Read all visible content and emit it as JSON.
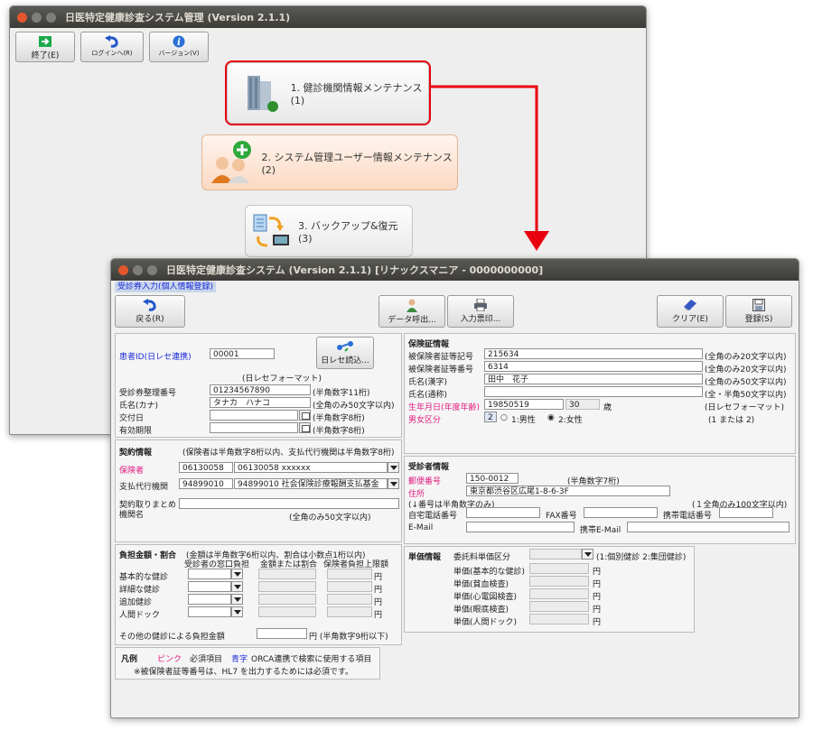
{
  "back_window": {
    "title": "日医特定健康診査システム管理 (Version 2.1.1)",
    "toolbar": {
      "exit": "終了(E)",
      "login": "ログインへ(R)",
      "version": "バージョン(V)"
    },
    "menu": [
      "1. 健診機関情報メンテナンス(1)",
      "2. システム管理ユーザー情報メンテナンス(2)",
      "3. バックアップ&復元(3)"
    ]
  },
  "front_window": {
    "title": "日医特定健康診査システム (Version 2.1.1) [リナックスマニア - 0000000000]",
    "subtitle": "受診券入力(個人情報登録)",
    "toolbar": {
      "back": "戻る(R)",
      "data_call": "データ呼出...",
      "print": "入力票印...",
      "clear": "クリア(E)",
      "register": "登録(S)"
    },
    "patient": {
      "id_label": "患者ID(日レセ連携)",
      "id_value": "00001",
      "read_button": "日レセ読込...",
      "format_note": "(日レセフォーマット)",
      "rows": [
        {
          "label": "受診券整理番号",
          "value": "01234567890",
          "note": "(半角数字11桁)"
        },
        {
          "label": "氏名(カナ)",
          "value": "タナカ　ハナコ",
          "note": "(全角のみ50文字以内)"
        },
        {
          "label": "交付日",
          "value": "",
          "note": "(半角数字8桁)"
        },
        {
          "label": "有効期限",
          "value": "",
          "note": "(半角数字8桁)"
        }
      ]
    },
    "contract": {
      "title": "契約情報",
      "note": "(保険者は半角数字8桁以内、支払代行機関は半角数字8桁)",
      "insurer_label": "保険者",
      "insurer_code": "06130058",
      "insurer_value": "06130058 xxxxxx",
      "agent_label": "支払代行機関",
      "agent_code": "94899010",
      "agent_value": "94899010 社会保険診療報酬支払基金",
      "summary_label_1": "契約取りまとめ",
      "summary_label_2": "機関名",
      "summary_note": "(全角のみ50文字以内)"
    },
    "burden": {
      "title": "負担金額・割合",
      "note": "(金額は半角数字6桁以内、割合は小数点1桁以内)",
      "col1": "受診者の窓口負担",
      "col2": "金額または割合",
      "col3": "保険者負担上限額",
      "rows": [
        "基本的な健診",
        "詳細な健診",
        "追加健診",
        "人間ドック"
      ],
      "unit": "円",
      "other_label": "その他の健診による負担金額",
      "other_note": "円 (半角数字9桁以下)"
    },
    "legend": {
      "title": "凡例",
      "pink": "ピンク",
      "pink_desc": "必須項目",
      "blue": "青字",
      "blue_desc": "ORCA連携で検索に使用する項目",
      "note": "※被保険者証等番号は、HL7 を出力するためには必須です。"
    },
    "insurance": {
      "title": "保険証情報",
      "rows": [
        {
          "label": "被保険者証等記号",
          "value": "215634",
          "note": "(全角のみ20文字以内)"
        },
        {
          "label": "被保険者証等番号",
          "value": "6314",
          "note": "(全角のみ20文字以内)"
        },
        {
          "label": "氏名(漢字)",
          "value": "田中　花子",
          "note": "(全角のみ50文字以内)"
        },
        {
          "label": "氏名(通称)",
          "value": "",
          "note": "(全・半角50文字以内)"
        }
      ],
      "birth_label": "生年月日(年度年齢)",
      "birth_value": "19850519",
      "age_value": "30",
      "age_unit": "歳",
      "birth_note": "(日レセフォーマット)",
      "sex_label": "男女区分",
      "sex_value": "2",
      "sex_male": "1:男性",
      "sex_female": "2:女性",
      "sex_note": "(1 または 2)"
    },
    "examinee": {
      "title": "受診者情報",
      "zip_label": "郵便番号",
      "zip_value": "150-0012",
      "zip_note": "(半角数字7桁)",
      "addr_label": "住所",
      "addr_value": "東京都渋谷区広尾1-8-6-3F",
      "addr_note_left": "(↓番号は半角数字のみ)",
      "addr_note_right": "(１全角のみ100文字以内)",
      "home_tel": "自宅電話番号",
      "fax": "FAX番号",
      "mobile_tel": "携帯電話番号",
      "email": "E-Mail",
      "mobile_email": "携帯E-Mail"
    },
    "unit_price": {
      "title": "単価情報",
      "type_label": "委託料単価区分",
      "type_note": "(1:個別健診 2:集団健診)",
      "rows": [
        "単価(基本的な健診)",
        "単価(貧血検査)",
        "単価(心電図検査)",
        "単価(眼底検査)",
        "単価(人間ドック)"
      ],
      "unit": "円"
    }
  },
  "colors": {
    "accent_red": "#e8000f",
    "pink": "#e0197e",
    "blue": "#1a2bd8"
  }
}
